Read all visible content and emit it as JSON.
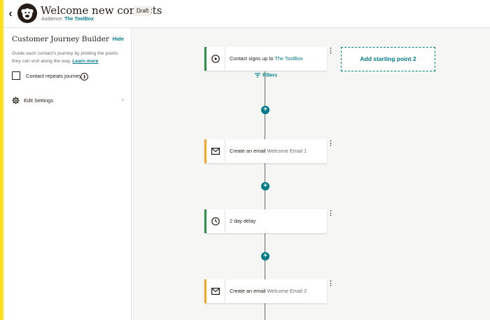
{
  "header": {
    "back_label": "‹",
    "title": "Welcome new contacts",
    "status_badge": "Draft",
    "audience_label": "Audience:",
    "audience_name": "The ToolBox"
  },
  "sidebar": {
    "title": "Customer Journey Builder",
    "hide_label": "Hide",
    "description": "Guide each contact's journey by plotting the points they can visit along the way.",
    "learn_more": "Learn more",
    "repeat_label": "Contact repeats journey",
    "repeat_checked": false,
    "edit_settings_label": "Edit Settings"
  },
  "canvas": {
    "trigger": {
      "prefix": "Contact signs up to ",
      "audience": "The ToolBox"
    },
    "filters_label": "Filters",
    "add_start_label": "Add starting point 2",
    "steps": [
      {
        "type": "email",
        "prefix": "Create an email ",
        "name": "Welcome Email 1"
      },
      {
        "type": "delay",
        "label": "2 day delay"
      },
      {
        "type": "email",
        "prefix": "Create an email ",
        "name": "Welcome Email 2"
      }
    ]
  },
  "colors": {
    "brand_yellow": "#ffe01b",
    "teal_accent": "#007c89",
    "trigger_green": "#2b9348",
    "email_orange": "#f5a623"
  },
  "icons": [
    "back-chevron-icon",
    "mailchimp-logo",
    "info-icon",
    "gear-icon",
    "chevron-right-icon",
    "play-icon",
    "filter-icon",
    "plus-icon",
    "envelope-icon",
    "clock-icon",
    "kebab-menu-icon"
  ]
}
